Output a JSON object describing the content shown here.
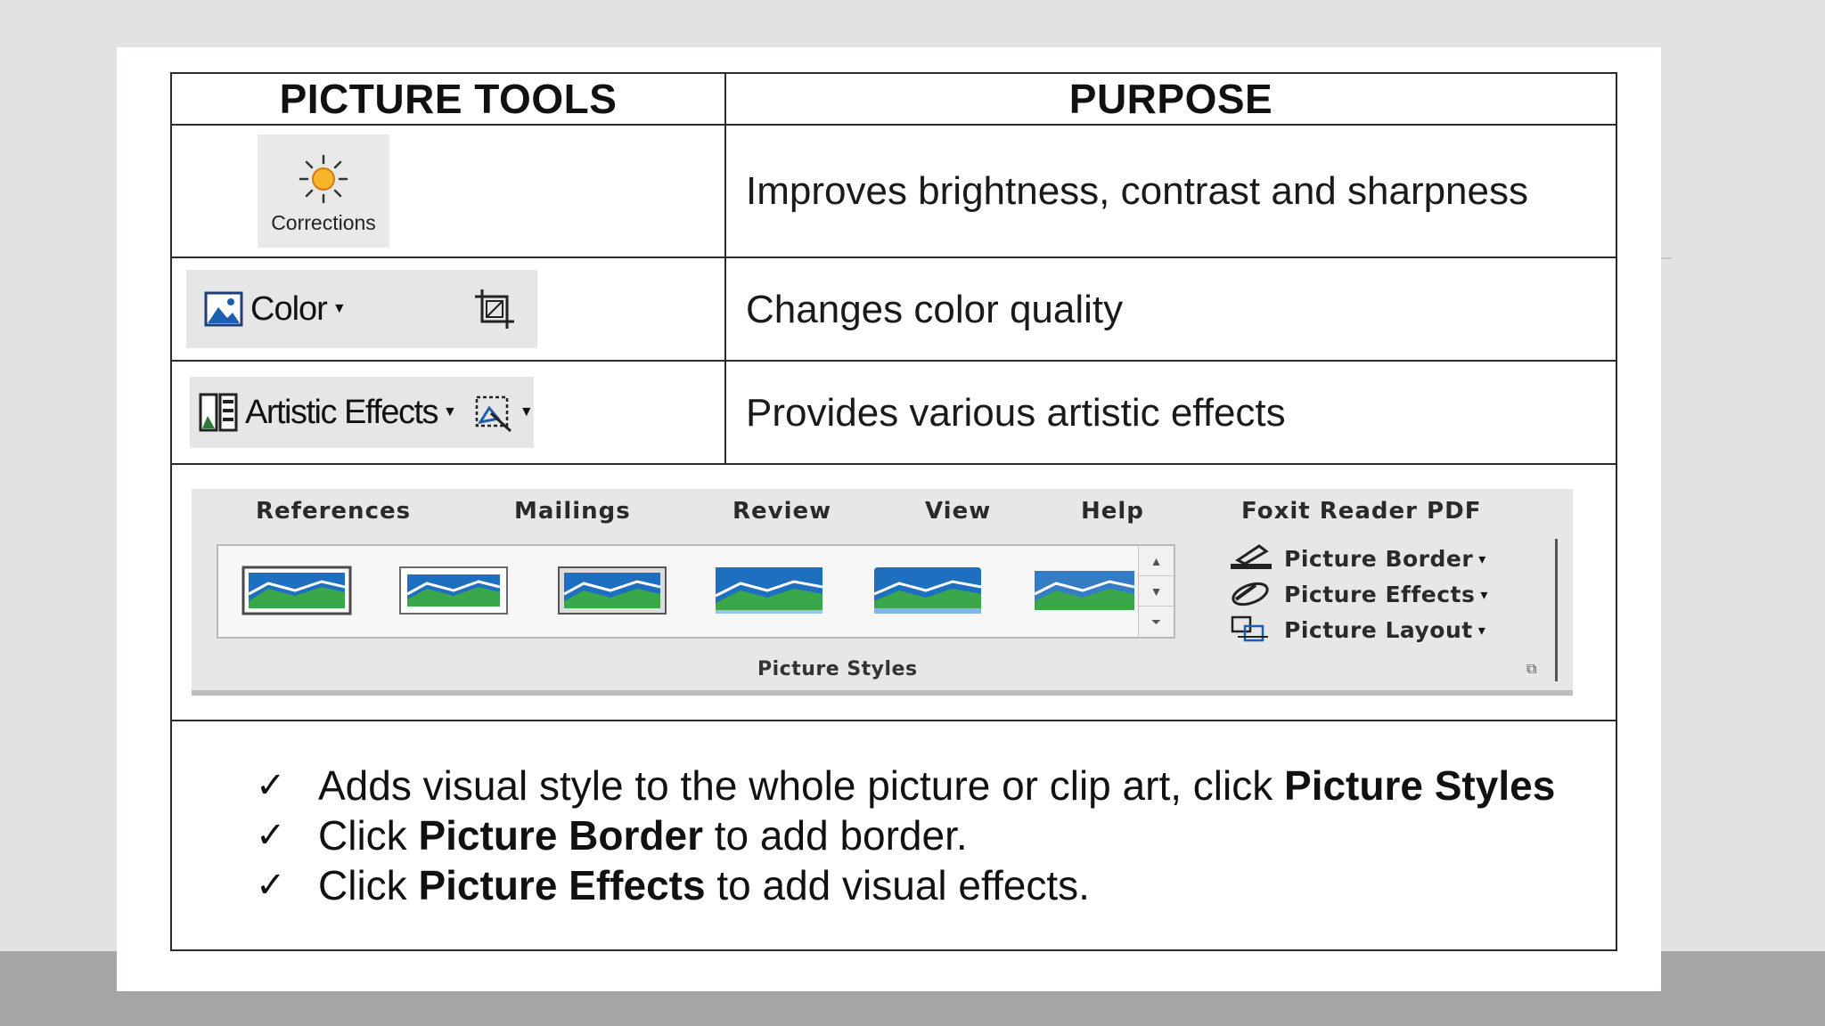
{
  "table": {
    "header": {
      "col1": "PICTURE TOOLS",
      "col2": "PURPOSE"
    },
    "rows": [
      {
        "tool": {
          "icon": "sun-icon",
          "label": "Corrections"
        },
        "purpose": "Improves brightness, contrast and sharpness"
      },
      {
        "tool": {
          "icon": "picture-icon",
          "label": "Color",
          "extra_icon": "crop-icon"
        },
        "purpose": "Changes color quality"
      },
      {
        "tool": {
          "icon": "artistic-effects-icon",
          "label": "Artistic Effects",
          "extra_icon": "remove-background-icon"
        },
        "purpose": "Provides various artistic effects"
      }
    ]
  },
  "ribbon": {
    "tabs": [
      "References",
      "Mailings",
      "Review",
      "View",
      "Help",
      "Foxit Reader PDF"
    ],
    "group_label": "Picture Styles",
    "commands": [
      {
        "icon": "pen-border-icon",
        "label": "Picture Border"
      },
      {
        "icon": "effects-icon",
        "label": "Picture Effects"
      },
      {
        "icon": "layout-icon",
        "label": "Picture Layout"
      }
    ],
    "thumb_count": 6
  },
  "bullets": {
    "b1": {
      "pre": "Adds visual style to the whole picture or clip art, click ",
      "bold": "Picture Styles",
      "post": ""
    },
    "b2": {
      "pre": "Click ",
      "bold": "Picture Border",
      "post": " to add border."
    },
    "b3": {
      "pre": "Click ",
      "bold": "Picture Effects",
      "post": " to add visual effects."
    },
    "check_glyph": "✓"
  },
  "colors": {
    "sun": "#f5a623",
    "landscape_green": "#3aa84a",
    "landscape_blue": "#1e6fbf"
  }
}
